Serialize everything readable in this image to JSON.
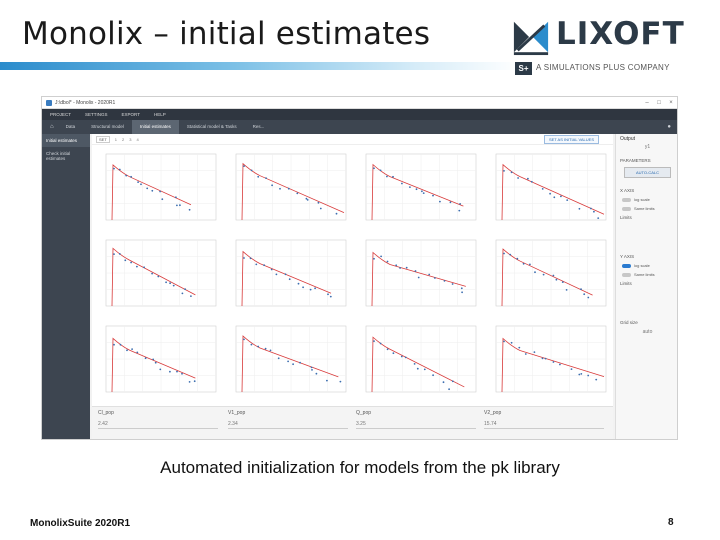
{
  "slide": {
    "title": "Monolix – initial estimates",
    "caption": "Automated initialization for models from the pk library",
    "footer_left": "MonolixSuite 2020R1",
    "page_number": "8"
  },
  "brand": {
    "name": "LIXOFT",
    "sp_badge": "S+",
    "tagline": "A SIMULATIONS PLUS COMPANY",
    "color": "#2c3a47",
    "accent": "#2b8ccc"
  },
  "app": {
    "window_title": "J:\\dbol* - Monolix - 2020R1",
    "menu": [
      "PROJECT",
      "SETTINGS",
      "EXPORT",
      "HELP"
    ],
    "tasks": [
      "Data",
      "Structural model",
      "Initial estimates",
      "Statistical model & Tasks",
      "Res..."
    ],
    "active_task": "Initial estimates",
    "sidebar": [
      "Initial estimates",
      "Check initial estimates"
    ],
    "toolbar": {
      "first_btn": "SET",
      "pager": [
        "1",
        "2",
        "3",
        "4"
      ],
      "select_label": "SET AS INITIAL VALUES"
    },
    "right_panel": {
      "output_label": "Output",
      "output_value": "y1",
      "parameters_label": "PARAMETERS",
      "auto_calc": "AUTO-CALC",
      "x_axis_label": "X AXIS",
      "y_axis_label": "Y AXIS",
      "log_scale": "log scale",
      "same_limits": "Same limits",
      "limits": "Limits",
      "grid_size_label": "Grid size",
      "grid_size_value": "auto",
      "y_log_scale_on": true,
      "x_log_scale_on": false
    },
    "parameters": [
      {
        "name": "Cl_pop",
        "value": "2.42"
      },
      {
        "name": "V1_pop",
        "value": "2.34"
      },
      {
        "name": "Q_pop",
        "value": "3.25"
      },
      {
        "name": "V2_pop",
        "value": "15.74"
      }
    ]
  },
  "colors": {
    "obs": "#3d6fb0",
    "pred": "#d83a3a",
    "dark_bar": "#2f3640"
  }
}
